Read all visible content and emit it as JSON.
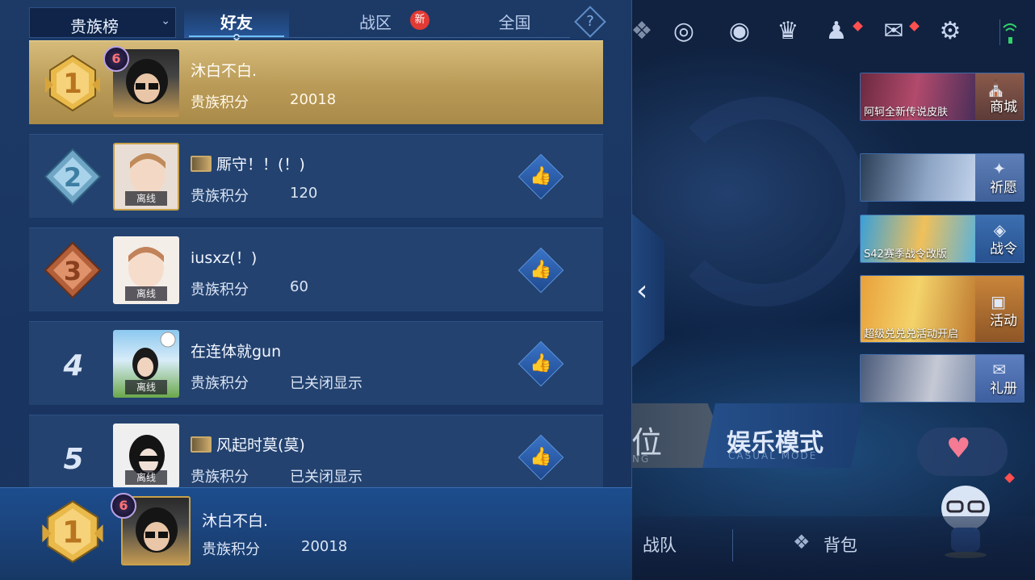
{
  "leaderboard": {
    "dropdown_label": "贵族榜",
    "tabs": [
      {
        "label": "好友",
        "active": true
      },
      {
        "label": "战区",
        "badge": "新"
      },
      {
        "label": "全国"
      }
    ],
    "help_label": "?",
    "score_label": "贵族积分",
    "offline_label": "离线",
    "rows": [
      {
        "rank": "1",
        "level": "6",
        "name": "沐白不白.",
        "score": "20018",
        "offline": false,
        "flag": false
      },
      {
        "rank": "2",
        "name": "厮守！！(！)",
        "score": "120",
        "offline": true,
        "flag": true
      },
      {
        "rank": "3",
        "name": "iusxz(！)",
        "score": "60",
        "offline": true,
        "flag": false
      },
      {
        "rank": "4",
        "name": "在连体就gun",
        "score": "已关闭显示",
        "offline": true,
        "flag": false
      },
      {
        "rank": "5",
        "name": "风起时莫(莫)",
        "score": "已关闭显示",
        "offline": true,
        "flag": true
      }
    ],
    "self": {
      "rank": "1",
      "level": "6",
      "name": "沐白不白.",
      "score": "20018"
    }
  },
  "lobby": {
    "banners": [
      {
        "caption": "阿轲全新传说皮肤",
        "label": "商城",
        "icon": "shop-icon"
      },
      {
        "caption": "",
        "label": "祈愿",
        "icon": "wish-icon"
      },
      {
        "caption": "S42赛季战令改版",
        "label": "战令",
        "icon": "battle-pass-icon"
      },
      {
        "caption": "超级兑兑兑活动开启",
        "label": "活动",
        "icon": "event-icon"
      },
      {
        "caption": "",
        "label": "礼册",
        "icon": "gift-book-icon"
      }
    ],
    "rank_mode": {
      "title": "位",
      "sub": "NG"
    },
    "casual_mode": {
      "title": "娱乐模式",
      "sub": "CASUAL MODE"
    },
    "bottom": {
      "team": "战队",
      "bag": "背包"
    }
  },
  "colors": {
    "panel_bg": "#1d3a67",
    "first_row_gold": "#c9ab66",
    "active_tab_underline": "#6ec0ff",
    "new_badge": "#e23a34",
    "level_badge_text": "#ff7373"
  }
}
